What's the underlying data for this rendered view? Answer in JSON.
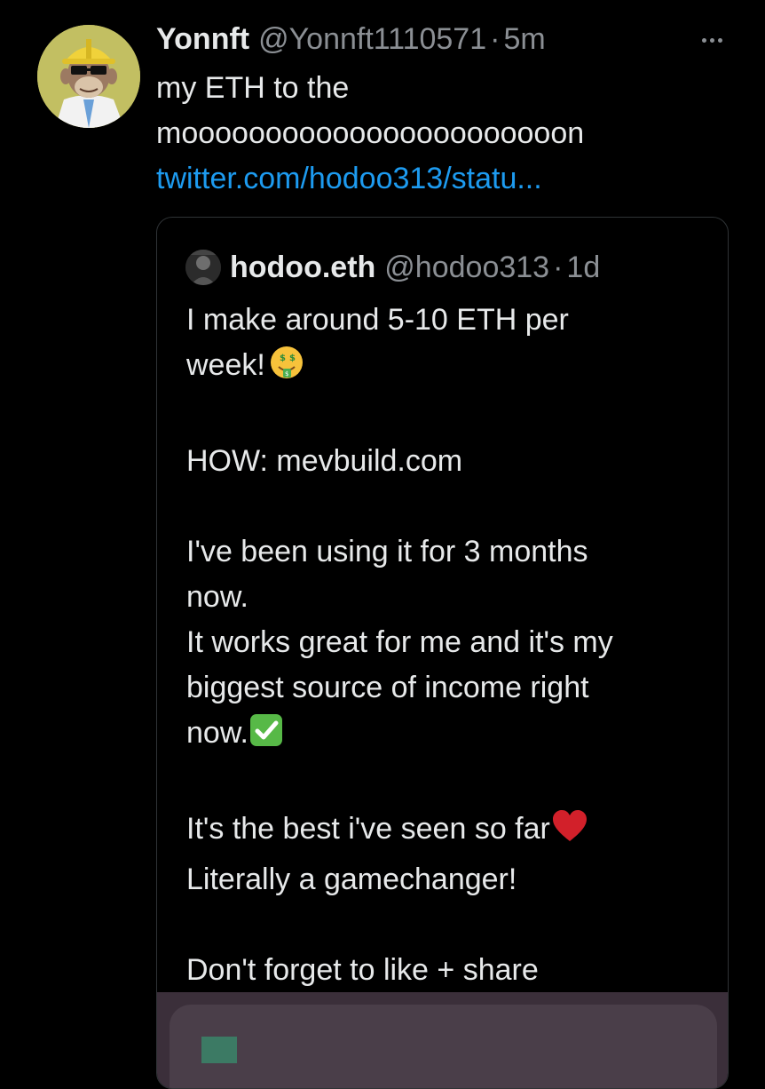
{
  "tweet": {
    "author": {
      "display_name": "Yonnft",
      "handle": "@Yonnft1110571",
      "separator": "·",
      "time": "5m"
    },
    "text_lines": [
      "my ETH to the",
      "mooooooooooooooooooooooon"
    ],
    "link": "twitter.com/hodoo313/statu...",
    "more_icon": "more-horizontal-icon"
  },
  "quote": {
    "author": {
      "display_name": "hodoo.eth",
      "handle": "@hodoo313",
      "separator": "·",
      "time": "1d"
    },
    "lines": [
      "I make around 5-10 ETH per",
      "week!",
      "",
      "HOW: mevbuild.com",
      "",
      "I've been using it for 3 months",
      "now.",
      "It works great for me and it's my",
      "biggest source of income right",
      "now.",
      "",
      "It's the best i've seen so far",
      "Literally a gamechanger!",
      "",
      "Don't forget to like + share"
    ],
    "emojis": {
      "money_mouth": "money-mouth-face-icon",
      "check": "check-mark-button-icon",
      "heart": "red-heart-icon"
    }
  },
  "colors": {
    "background": "#000000",
    "text": "#e7e9ea",
    "secondary": "#8b8f94",
    "link": "#1d9bf0",
    "border": "#2f3336"
  }
}
